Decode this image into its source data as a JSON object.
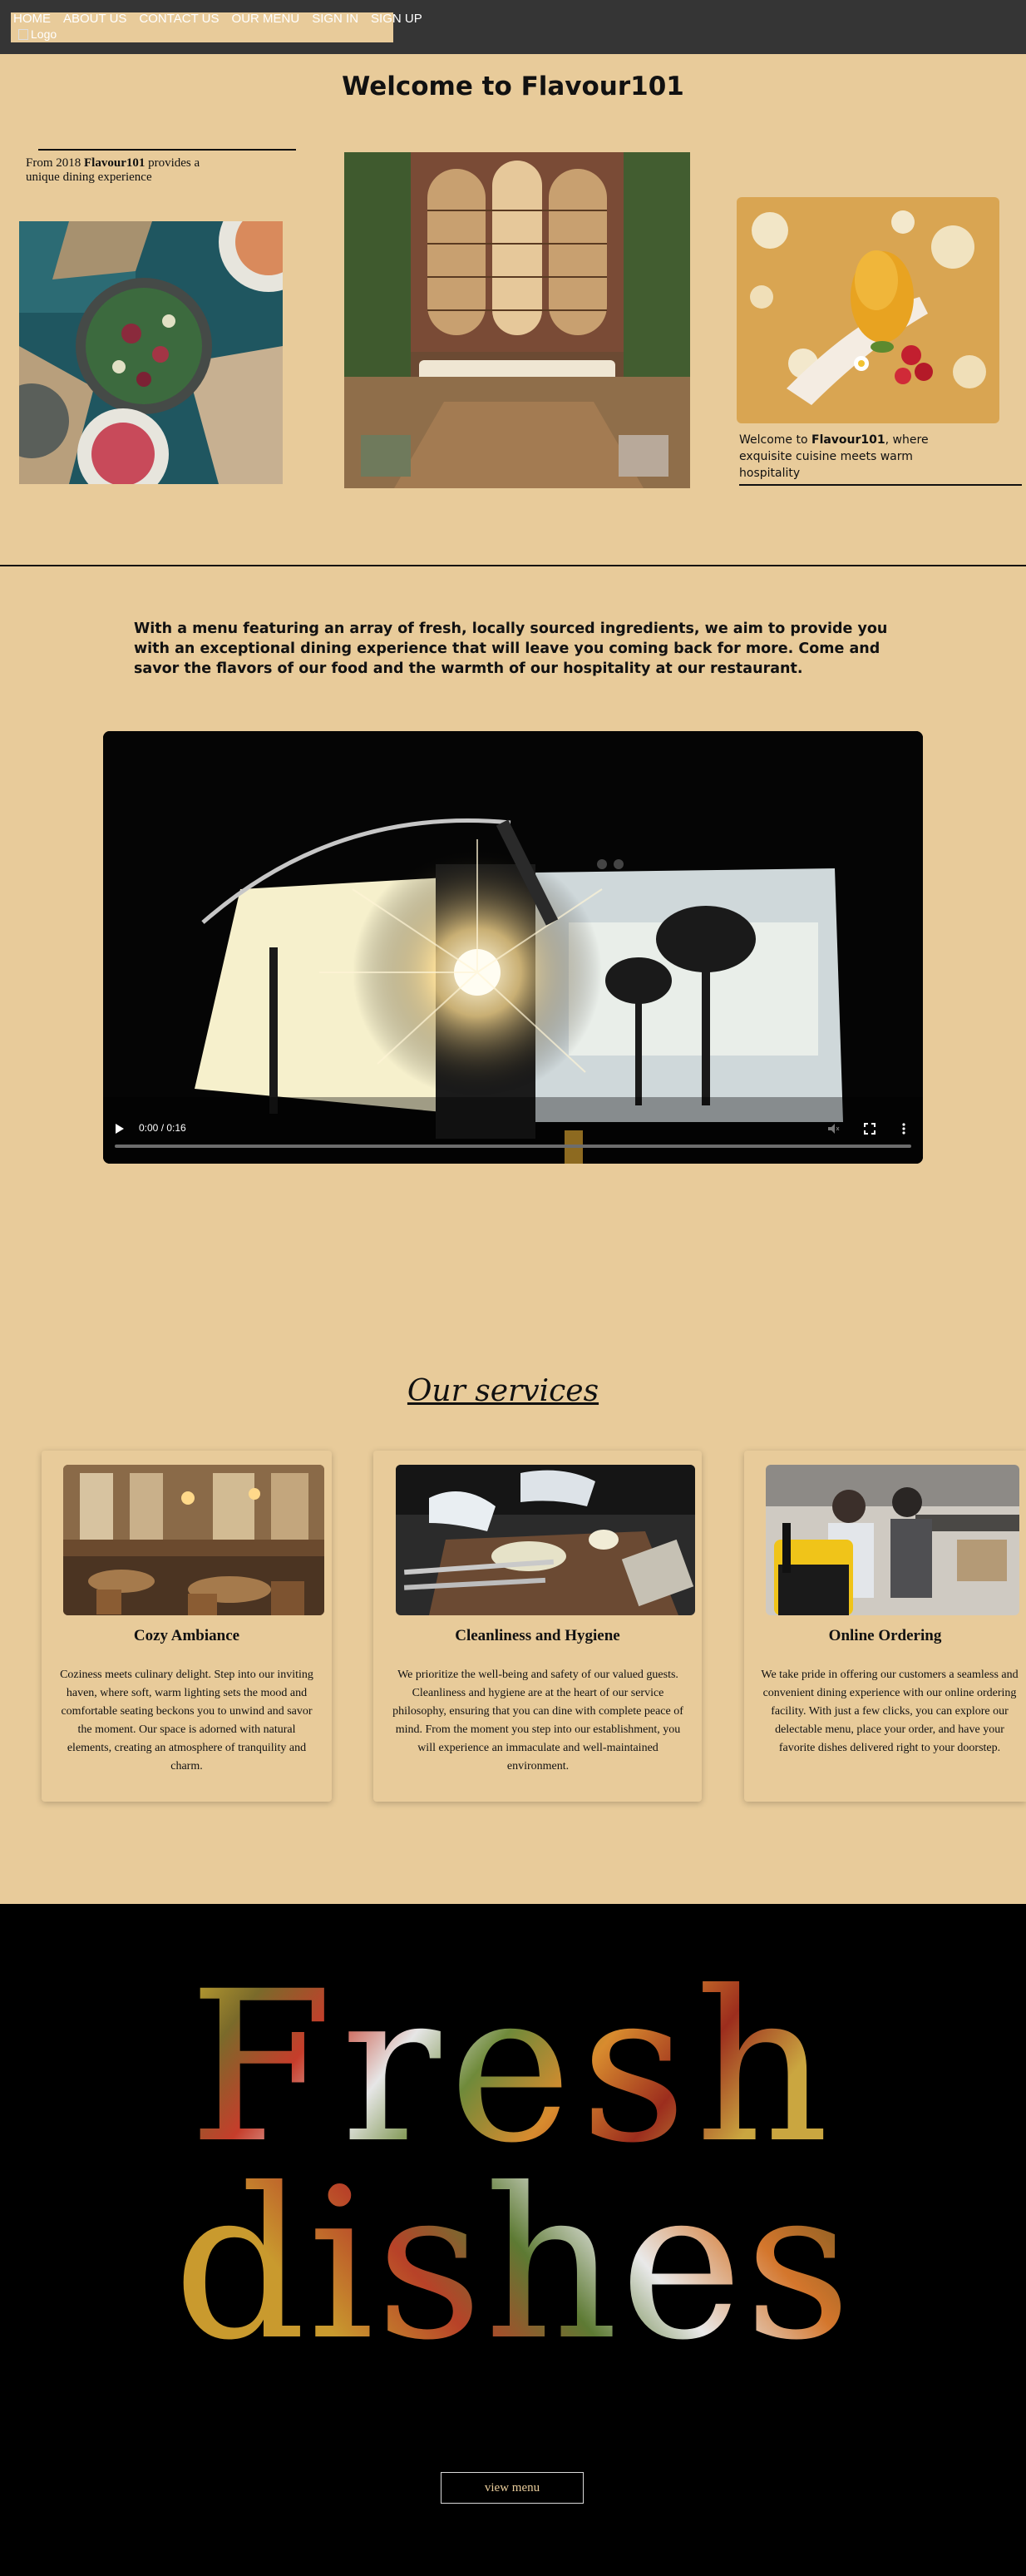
{
  "nav": {
    "items": [
      "HOME",
      "ABOUT US",
      "CONTACT US",
      "OUR MENU",
      "SIGN IN",
      "SIGN UP"
    ],
    "logo_alt": "Logo"
  },
  "hero": {
    "title": "Welcome to Flavour101",
    "left_caption_pre": "From 2018 ",
    "left_caption_brand": "Flavour101",
    "left_caption_post": " provides a unique dining experience",
    "right_caption_pre": "Welcome to ",
    "right_caption_brand": "Flavour101",
    "right_caption_post": ", where exquisite cuisine meets warm hospitality"
  },
  "intro": {
    "text": "With a menu featuring an array of fresh, locally sourced ingredients, we aim to provide you with an exceptional dining experience that will leave you coming back for more. Come and savor the flavors of our food and the warmth of our hospitality at our restaurant."
  },
  "video": {
    "time": "0:00 / 0:16",
    "progress": 0
  },
  "services": {
    "title": "Our services",
    "cards": [
      {
        "title": "Cozy Ambiance",
        "text": "Coziness meets culinary delight. Step into our inviting haven, where soft, warm lighting sets the mood and comfortable seating beckons you to unwind and savor the moment. Our space is adorned with natural elements, creating an atmosphere of tranquility and charm."
      },
      {
        "title": "Cleanliness and Hygiene",
        "text": "We prioritize the well-being and safety of our valued guests. Cleanliness and hygiene are at the heart of our service philosophy, ensuring that you can dine with complete peace of mind. From the moment you step into our establishment, you will experience an immaculate and well-maintained environment."
      },
      {
        "title": "Online Ordering",
        "text": "We take pride in offering our customers a seamless and convenient dining experience with our online ordering facility. With just a few clicks, you can explore our delectable menu, place your order, and have your favorite dishes delivered right to your doorstep."
      }
    ]
  },
  "promo": {
    "line1": "Fresh",
    "line2": "dishes",
    "button": "view menu"
  },
  "colors": {
    "background": "#e8cb9a",
    "topbar": "#353535",
    "footer": "#000000"
  }
}
